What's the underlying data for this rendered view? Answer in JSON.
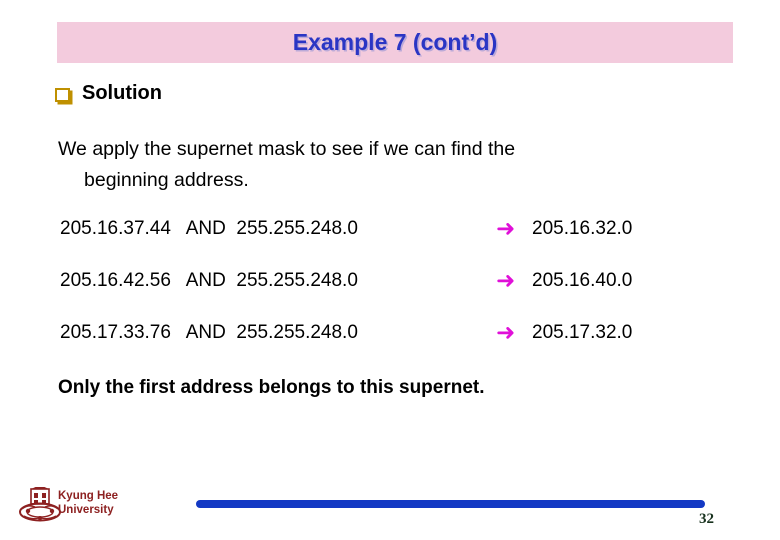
{
  "slide": {
    "title": "Example 7 (cont’d)",
    "title_color": "#2a35c4",
    "banner_color": "#f3cbdd",
    "heading": {
      "bullet_icon": "square-bullet-icon",
      "bullet_color": "#bf9000",
      "label": "Solution"
    },
    "body": {
      "line1": "We apply the supernet mask to see if we can find the",
      "line2": "beginning address."
    },
    "calculations": {
      "arrow_icon": "right-arrow-icon",
      "arrow_color": "#e010d8",
      "arrow_glyph": "➜",
      "rows": [
        {
          "address": "205.16.37.44",
          "operator": "AND",
          "mask": "255.255.248.0",
          "left": "205.16.37.44   AND  255.255.248.0",
          "result": "205.16.32.0"
        },
        {
          "address": "205.16.42.56",
          "operator": "AND",
          "mask": "255.255.248.0",
          "left": "205.16.42.56   AND  255.255.248.0",
          "result": "205.16.40.0"
        },
        {
          "address": "205.17.33.76",
          "operator": "AND",
          "mask": "255.255.248.0",
          "left": "205.17.33.76   AND  255.255.248.0",
          "result": "205.17.32.0"
        }
      ]
    },
    "conclusion": "Only the first address belongs to this supernet."
  },
  "footer": {
    "logo_icon": "kyung-hee-crest-icon",
    "org_line1": "Kyung Hee",
    "org_line2": "University",
    "org_color": "#8d2121",
    "bar_color": "#1339c4",
    "page_number": "32"
  }
}
